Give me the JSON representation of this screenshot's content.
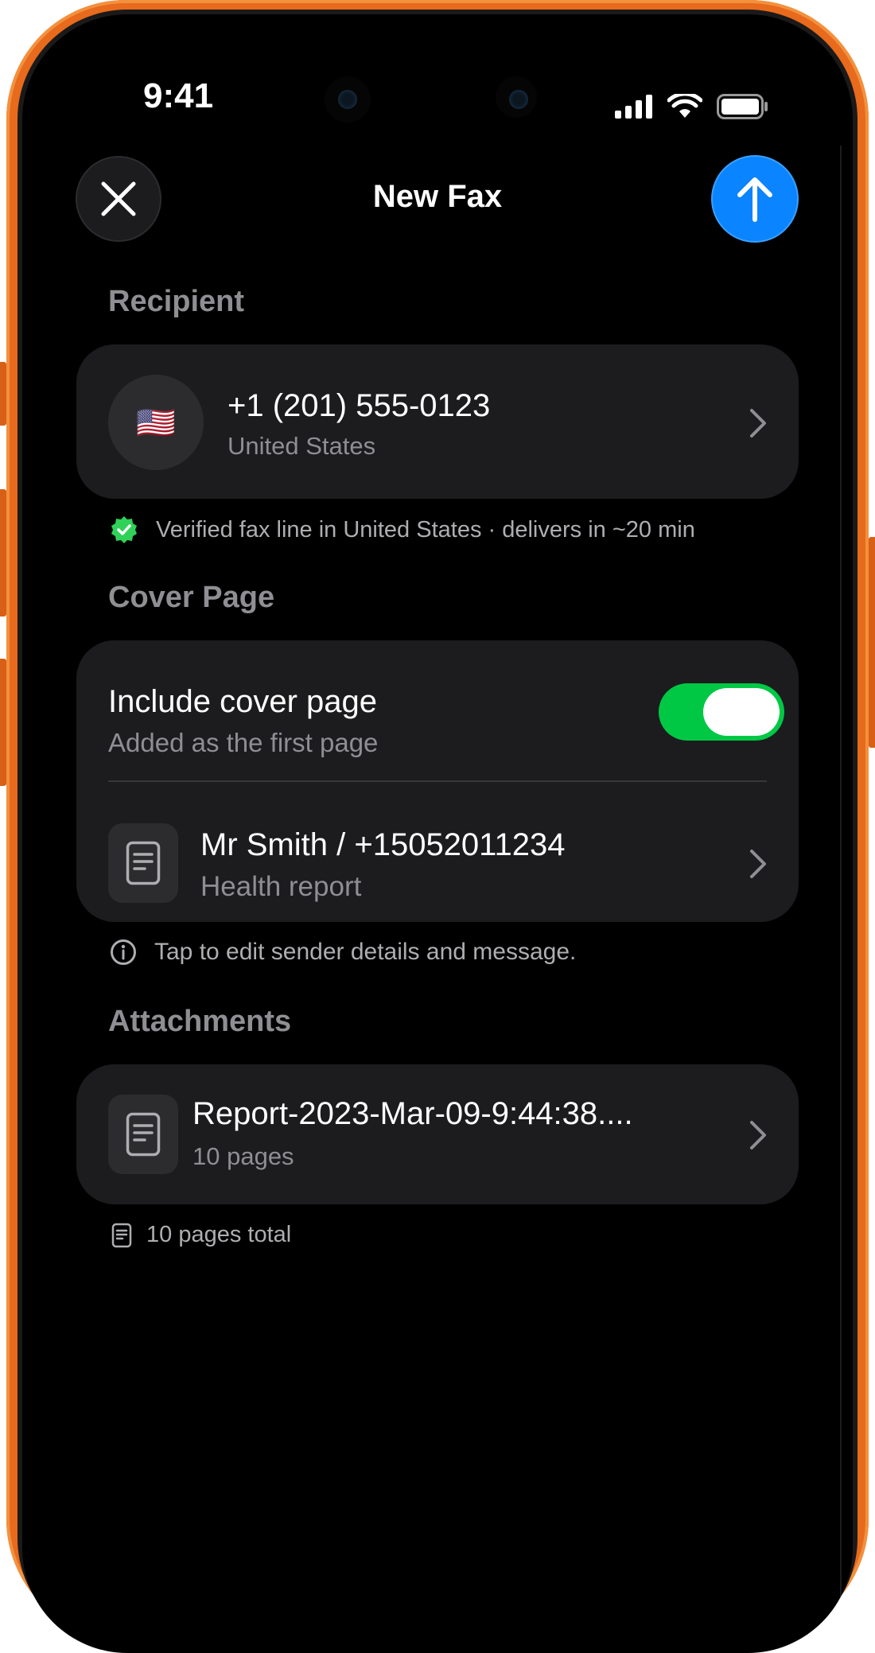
{
  "status_bar": {
    "time": "9:41"
  },
  "nav": {
    "title": "New Fax"
  },
  "recipient": {
    "section_title": "Recipient",
    "flag": "🇺🇸",
    "number": "+1 (201) 555-0123",
    "country": "United States",
    "verified_note": "Verified fax line in United States · delivers in ~20 min"
  },
  "cover_page": {
    "section_title": "Cover Page",
    "toggle_label": "Include cover page",
    "toggle_sublabel": "Added as the first page",
    "toggle_on": true,
    "sender": "Mr Smith / +15052011234",
    "subject": "Health report",
    "info_note": "Tap to edit sender details and message."
  },
  "attachments": {
    "section_title": "Attachments",
    "items": [
      {
        "name": "Report-2023-Mar-09-9:44:38....",
        "pages": "10 pages"
      }
    ],
    "total": "10 pages total"
  },
  "colors": {
    "accent_blue": "#0a84ff",
    "toggle_green": "#00c844",
    "verified_green": "#30d158",
    "frame_orange": "#e86a1c"
  }
}
